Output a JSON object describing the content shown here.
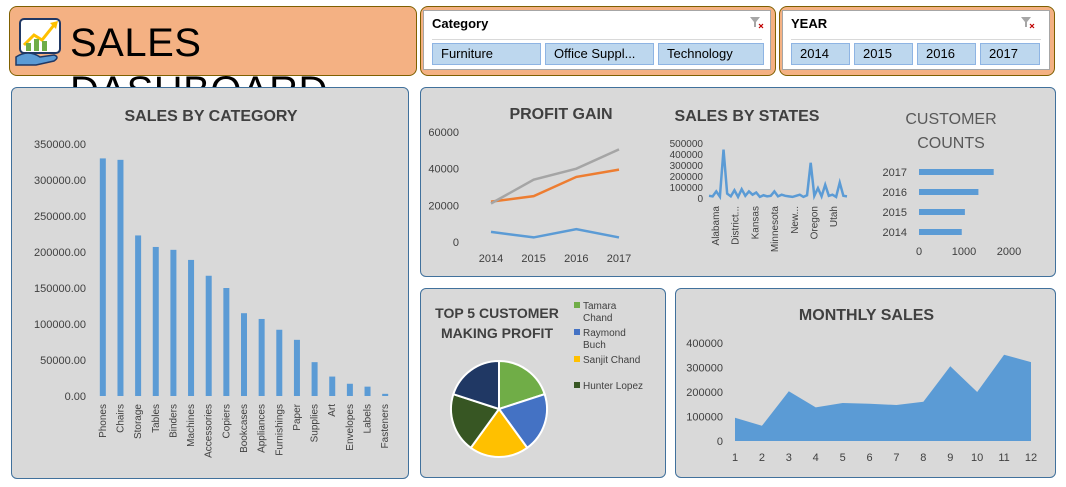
{
  "header": {
    "title": "SALES DASHBOARD",
    "logo_icon": "growth-chart-hand-icon"
  },
  "filters": {
    "category": {
      "title": "Category",
      "options": [
        "Furniture",
        "Office Suppl...",
        "Technology"
      ]
    },
    "year": {
      "title": "YEAR",
      "options": [
        "2014",
        "2015",
        "2016",
        "2017"
      ]
    }
  },
  "colors": {
    "blue": "#5b9bd5",
    "orange": "#ed7d31",
    "gray": "#a5a5a5",
    "green": "#70ad47",
    "royal": "#4472c4",
    "gold": "#ffc000",
    "darkgreen": "#375623",
    "navy": "#203864",
    "banner": "#f4b183"
  },
  "chart_data": [
    {
      "id": "sales_by_category",
      "type": "bar",
      "title": "SALES BY CATEGORY",
      "categories": [
        "Phones",
        "Chairs",
        "Storage",
        "Tables",
        "Binders",
        "Machines",
        "Accessories",
        "Copiers",
        "Bookcases",
        "Appliances",
        "Furnishings",
        "Paper",
        "Supplies",
        "Art",
        "Envelopes",
        "Labels",
        "Fasteners"
      ],
      "values": [
        330000,
        328000,
        223000,
        207000,
        203000,
        189000,
        167000,
        150000,
        115000,
        107000,
        92000,
        78000,
        47000,
        27000,
        17000,
        13000,
        3000
      ],
      "yticks": [
        "0.00",
        "50000.00",
        "100000.00",
        "150000.00",
        "200000.00",
        "250000.00",
        "300000.00",
        "350000.00"
      ],
      "ylim": [
        0,
        350000
      ]
    },
    {
      "id": "profit_gain",
      "type": "line",
      "title": "PROFIT GAIN",
      "categories": [
        "2014",
        "2015",
        "2016",
        "2017"
      ],
      "series": [
        {
          "values": [
            5500,
            2500,
            7000,
            2500
          ],
          "color": "#5b9bd5"
        },
        {
          "values": [
            22000,
            25000,
            35500,
            39500
          ],
          "color": "#ed7d31"
        },
        {
          "values": [
            21000,
            34000,
            40000,
            50500
          ],
          "color": "#a5a5a5"
        }
      ],
      "yticks": [
        "0",
        "20000",
        "40000",
        "60000"
      ],
      "ylim": [
        0,
        60000
      ]
    },
    {
      "id": "sales_by_states",
      "type": "line",
      "title": "SALES BY STATES",
      "values": [
        20000,
        15000,
        60000,
        12000,
        440000,
        40000,
        15000,
        70000,
        10000,
        80000,
        20000,
        60000,
        30000,
        50000,
        10000,
        25000,
        15000,
        20000,
        60000,
        15000,
        30000,
        20000,
        15000,
        10000,
        20000,
        30000,
        10000,
        25000,
        320000,
        20000,
        90000,
        15000,
        120000,
        20000,
        30000,
        10000,
        140000,
        20000,
        15000
      ],
      "tick_labels": [
        "Alabama",
        "District...",
        "Kansas",
        "Minnesota",
        "New...",
        "Oregon",
        "Utah"
      ],
      "yticks": [
        "0",
        "100000",
        "200000",
        "300000",
        "400000",
        "500000"
      ],
      "ylim": [
        0,
        500000
      ]
    },
    {
      "id": "customer_counts",
      "type": "bar",
      "title_lines": [
        "CUSTOMER",
        "COUNTS"
      ],
      "categories": [
        "2017",
        "2016",
        "2015",
        "2014"
      ],
      "values": [
        1660,
        1320,
        1020,
        950
      ],
      "xticks": [
        "0",
        "1000",
        "2000"
      ],
      "xlim": [
        0,
        2000
      ]
    },
    {
      "id": "top5_customers",
      "type": "pie",
      "title_lines": [
        "TOP 5 CUSTOMER",
        "MAKING PROFIT"
      ],
      "slices": [
        {
          "label": "Tamara Chand",
          "value": 20,
          "color": "#70ad47"
        },
        {
          "label": "Raymond Buch",
          "value": 20,
          "color": "#4472c4"
        },
        {
          "label": "Sanjit Chand",
          "value": 20,
          "color": "#ffc000"
        },
        {
          "label": "Hunter Lopez",
          "value": 20,
          "color": "#375623"
        },
        {
          "label": "",
          "value": 20,
          "color": "#203864"
        }
      ],
      "legend": [
        {
          "lines": [
            "Tamara",
            "Chand"
          ],
          "color": "#70ad47"
        },
        {
          "lines": [
            "Raymond",
            "Buch"
          ],
          "color": "#4472c4"
        },
        {
          "lines": [
            "Sanjit Chand"
          ],
          "color": "#ffc000"
        },
        {
          "lines": [
            "Hunter Lopez"
          ],
          "color": "#375623"
        }
      ]
    },
    {
      "id": "monthly_sales",
      "type": "area",
      "title": "MONTHLY SALES",
      "categories": [
        "1",
        "2",
        "3",
        "4",
        "5",
        "6",
        "7",
        "8",
        "9",
        "10",
        "11",
        "12"
      ],
      "values": [
        95000,
        62000,
        203000,
        137000,
        155000,
        152000,
        147000,
        160000,
        305000,
        200000,
        352000,
        322000
      ],
      "yticks": [
        "0",
        "100000",
        "200000",
        "300000",
        "400000"
      ],
      "ylim": [
        0,
        400000
      ]
    }
  ]
}
